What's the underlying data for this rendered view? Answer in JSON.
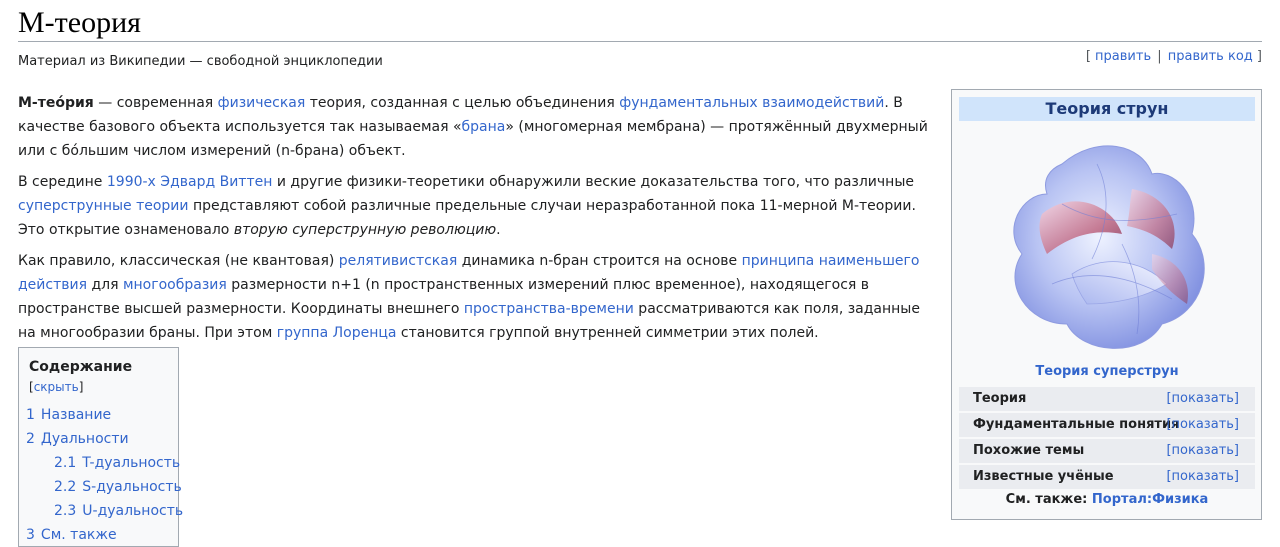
{
  "page": {
    "title": "М-теория",
    "tagline": "Материал из Википедии — свободной энциклопедии",
    "edit": "править",
    "edit_code": "править код",
    "bracket_open": "[",
    "bracket_close": "]",
    "separator": "|"
  },
  "article": {
    "p1": [
      {
        "t": "М-тео́рия",
        "b": true
      },
      {
        "t": " — современная "
      },
      {
        "t": "физическая",
        "link": true
      },
      {
        "t": " теория, созданная с целью объединения "
      },
      {
        "t": "фундаментальных взаимодействий",
        "link": true
      },
      {
        "t": ". В качестве базового объекта используется так называемая «"
      },
      {
        "t": "брана",
        "link": true
      },
      {
        "t": "» (многомерная мембрана) — протяжённый двухмерный или с бо́льшим числом измерений (n-брана) объект."
      }
    ],
    "p2": [
      {
        "t": "В середине "
      },
      {
        "t": "1990-х",
        "link": true
      },
      {
        "t": " "
      },
      {
        "t": "Эдвард Виттен",
        "link": true
      },
      {
        "t": " и другие физики-теоретики обнаружили веские доказательства того, что различные "
      },
      {
        "t": "суперструнные теории",
        "link": true
      },
      {
        "t": " представляют собой различные предельные случаи неразработанной пока 11-мерной М-теории. Это открытие ознаменовало "
      },
      {
        "t": "вторую суперструнную революцию",
        "i": true
      },
      {
        "t": "."
      }
    ],
    "p3": [
      {
        "t": "Как правило, классическая (не квантовая) "
      },
      {
        "t": "релятивистская",
        "link": true
      },
      {
        "t": " динамика n-бран строится на основе "
      },
      {
        "t": "принципа наименьшего действия",
        "link": true
      },
      {
        "t": " для "
      },
      {
        "t": "многообразия",
        "link": true
      },
      {
        "t": " размерности n+1 (n пространственных измерений плюс временное), находящегося в пространстве высшей размерности. Координаты внешнего "
      },
      {
        "t": "пространства-времени",
        "link": true
      },
      {
        "t": " рассматриваются как поля, заданные на многообразии браны. При этом "
      },
      {
        "t": "группа Лоренца",
        "link": true
      },
      {
        "t": " становится группой внутренней симметрии этих полей."
      }
    ]
  },
  "toc": {
    "title": "Содержание",
    "hide": "скрыть",
    "items": [
      {
        "num": "1",
        "label": "Название",
        "level": 1
      },
      {
        "num": "2",
        "label": "Дуальности",
        "level": 1
      },
      {
        "num": "2.1",
        "label": "T-дуальность",
        "level": 2
      },
      {
        "num": "2.2",
        "label": "S-дуальность",
        "level": 2
      },
      {
        "num": "2.3",
        "label": "U-дуальность",
        "level": 2
      },
      {
        "num": "3",
        "label": "См. также",
        "level": 1
      }
    ]
  },
  "infobox": {
    "title": "Теория струн",
    "image_icon": "calabi-yau-manifold-illustration",
    "caption": "Теория суперструн",
    "show_label": "[показать]",
    "rows": [
      {
        "label": "Теория"
      },
      {
        "label": "Фундаментальные понятия"
      },
      {
        "label": "Похожие темы"
      },
      {
        "label": "Известные учёные"
      }
    ],
    "see_also_label": "См. также:",
    "see_also_link": "Портал:Физика"
  },
  "colors": {
    "link": "#3366cc",
    "infobox_header": "#d0e4fb",
    "infobox_row": "#eaecf0",
    "border": "#a2a9b1"
  }
}
